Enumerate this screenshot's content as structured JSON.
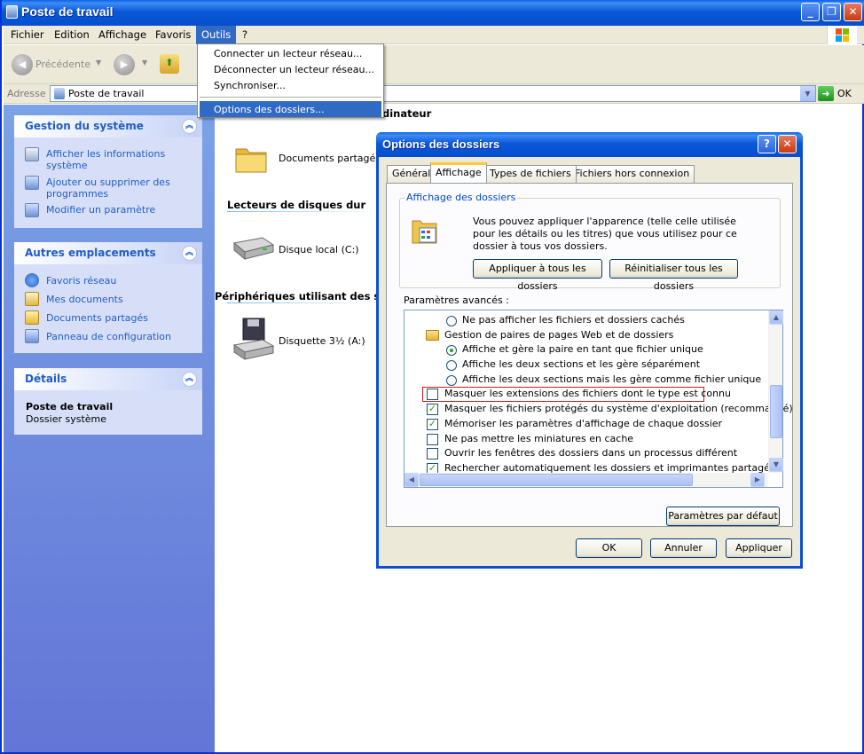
{
  "window": {
    "title": "Poste de travail"
  },
  "menubar": {
    "items": [
      "Fichier",
      "Edition",
      "Affichage",
      "Favoris",
      "Outils",
      "?"
    ]
  },
  "toolbar": {
    "back_label": "Précédente"
  },
  "address": {
    "label": "Adresse",
    "value": "Poste de travail",
    "go_label": "OK"
  },
  "left": {
    "system": {
      "title": "Gestion du système",
      "links": [
        "Afficher les informations système",
        "Ajouter ou supprimer des programmes",
        "Modifier un paramètre"
      ]
    },
    "places": {
      "title": "Autres emplacements",
      "links": [
        "Favoris réseau",
        "Mes documents",
        "Documents partagés",
        "Panneau de configuration"
      ]
    },
    "details": {
      "title": "Détails",
      "name": "Poste de travail",
      "type": "Dossier système"
    }
  },
  "main": {
    "group1_partial": "dinateur",
    "shared_docs": "Documents partagés",
    "group2": "Lecteurs de disques dur",
    "disk_c": "Disque local (C:)",
    "group3": "Périphériques utilisant des s",
    "floppy": "Disquette 3½ (A:)"
  },
  "dropdown": {
    "items": [
      "Connecter un lecteur réseau...",
      "Déconnecter un lecteur réseau...",
      "Synchroniser...",
      "Options des dossiers..."
    ]
  },
  "dialog": {
    "title": "Options des dossiers",
    "tabs": [
      "Général",
      "Affichage",
      "Types de fichiers",
      "Fichiers hors connexion"
    ],
    "view_group_title": "Affichage des dossiers",
    "view_text": "Vous pouvez appliquer l'apparence (telle celle utilisée pour les détails ou les titres) que vous utilisez pour ce dossier à tous vos dossiers.",
    "apply_all": "Appliquer à tous les dossiers",
    "reset_all": "Réinitialiser tous les dossiers",
    "advanced_label": "Paramètres avancés :",
    "options": [
      {
        "text": "Ne pas afficher les fichiers et dossiers cachés",
        "kind": "radio",
        "checked": false
      },
      {
        "text": "Gestion de paires de pages Web et de dossiers",
        "kind": "folder",
        "checked": false
      },
      {
        "text": "Affiche et gère la paire en tant que fichier unique",
        "kind": "radio",
        "checked": true
      },
      {
        "text": "Affiche les deux sections et les gère séparément",
        "kind": "radio",
        "checked": false
      },
      {
        "text": "Affiche les deux sections mais les gère comme fichier unique",
        "kind": "radio",
        "checked": false
      },
      {
        "text": "Masquer les extensions des fichiers dont le type est connu",
        "kind": "check",
        "checked": false
      },
      {
        "text": "Masquer les fichiers protégés du système d'exploitation (recommandé)",
        "kind": "check",
        "checked": true
      },
      {
        "text": "Mémoriser les paramètres d'affichage de chaque dossier",
        "kind": "check",
        "checked": true
      },
      {
        "text": "Ne pas mettre les miniatures en cache",
        "kind": "check",
        "checked": false
      },
      {
        "text": "Ouvrir les fenêtres des dossiers dans un processus différent",
        "kind": "check",
        "checked": false
      },
      {
        "text": "Rechercher automatiquement les dossiers et imprimantes partagés",
        "kind": "check",
        "checked": true
      }
    ],
    "defaults_button": "Paramètres par défaut",
    "ok": "OK",
    "cancel": "Annuler",
    "apply": "Appliquer"
  }
}
